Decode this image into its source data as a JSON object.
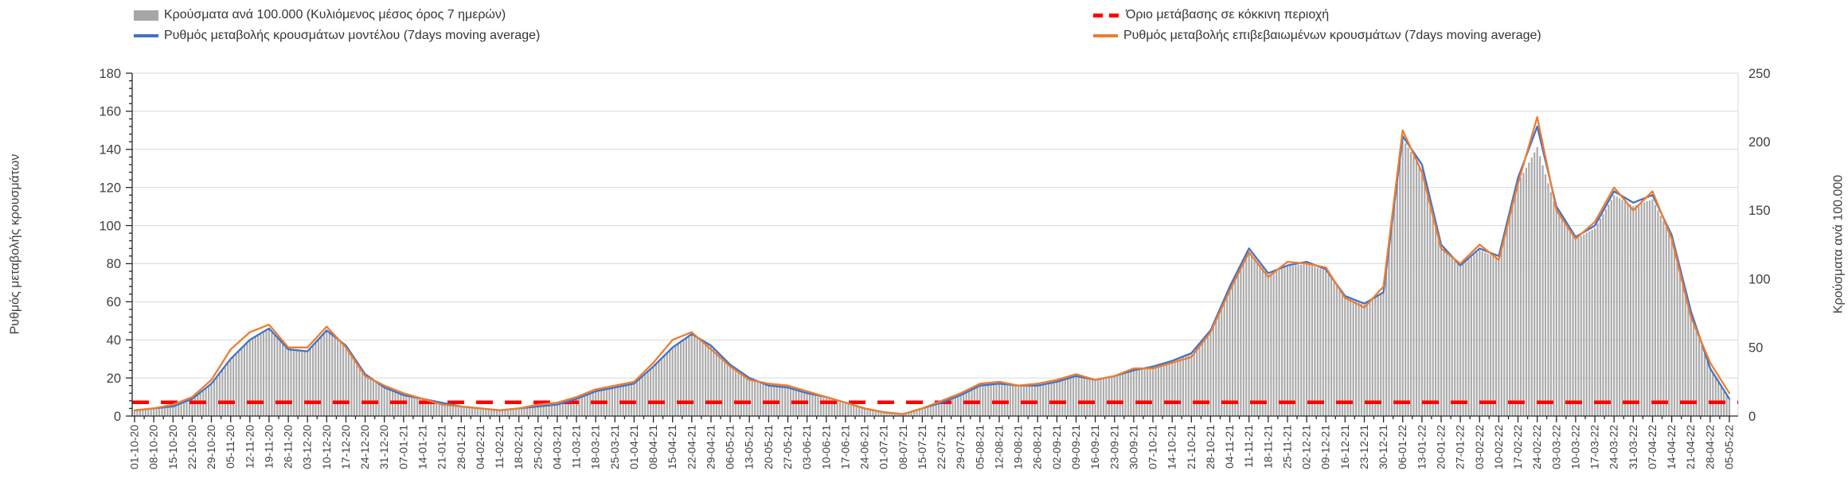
{
  "legend": [
    {
      "label": "Κρούσματα ανά 100.000 (Κυλιόμενος μέσος όρος 7 ημερών)",
      "type": "bar",
      "color": "#a6a6a6"
    },
    {
      "label": "Ρυθμός μεταβολής κρουσμάτων μοντέλου (7days moving average)",
      "type": "line",
      "color": "#4472c4"
    },
    {
      "label": "Όριο μετάβασης σε κόκκινη περιοχή",
      "type": "dash",
      "color": "#ff0000"
    },
    {
      "label": "Ρυθμός μεταβολής επιβεβαιωμένων κρουσμάτων (7days moving average)",
      "type": "line",
      "color": "#ed7d31"
    }
  ],
  "chart_data": {
    "type": "bar",
    "subtype": "combo-bar-line",
    "grid": "horizontal",
    "legend_position": "top",
    "left_axis": {
      "label": "Ρυθμός μεταβολής κρουσμάτων",
      "min": 0,
      "max": 180,
      "step": 20,
      "minor_step": 4
    },
    "right_axis": {
      "label": "Κρούσματα ανά 100.000",
      "min": 0,
      "max": 250,
      "step": 50
    },
    "categories": [
      "01-10-20",
      "08-10-20",
      "15-10-20",
      "22-10-20",
      "29-10-20",
      "05-11-20",
      "12-11-20",
      "19-11-20",
      "26-11-20",
      "03-12-20",
      "10-12-20",
      "17-12-20",
      "24-12-20",
      "31-12-20",
      "07-01-21",
      "14-01-21",
      "21-01-21",
      "28-01-21",
      "04-02-21",
      "11-02-21",
      "18-02-21",
      "25-02-21",
      "04-03-21",
      "11-03-21",
      "18-03-21",
      "25-03-21",
      "01-04-21",
      "08-04-21",
      "15-04-21",
      "22-04-21",
      "29-04-21",
      "06-05-21",
      "13-05-21",
      "20-05-21",
      "27-05-21",
      "03-06-21",
      "10-06-21",
      "17-06-21",
      "24-06-21",
      "01-07-21",
      "08-07-21",
      "15-07-21",
      "22-07-21",
      "29-07-21",
      "05-08-21",
      "12-08-21",
      "19-08-21",
      "26-08-21",
      "02-09-21",
      "09-09-21",
      "16-09-21",
      "23-09-21",
      "30-09-21",
      "07-10-21",
      "14-10-21",
      "21-10-21",
      "28-10-21",
      "04-11-21",
      "11-11-21",
      "18-11-21",
      "25-11-21",
      "02-12-21",
      "09-12-21",
      "16-12-21",
      "23-12-21",
      "30-12-21",
      "06-01-22",
      "13-01-22",
      "20-01-22",
      "27-01-22",
      "03-02-22",
      "10-02-22",
      "17-02-22",
      "24-02-22",
      "03-03-22",
      "10-03-22",
      "17-03-22",
      "24-03-22",
      "31-03-22",
      "07-04-22",
      "14-04-22",
      "21-04-22",
      "28-04-22",
      "05-05-22"
    ],
    "series": [
      {
        "name": "Κρούσματα ανά 100.000 (Κυλιόμενος μέσος όρος 7 ημερών)",
        "type": "bar",
        "axis": "right",
        "color": "#ababab",
        "values": [
          4,
          5,
          7,
          12,
          23,
          41,
          55,
          63,
          48,
          47,
          62,
          51,
          30,
          21,
          15,
          12,
          9,
          7,
          5,
          4,
          5,
          7,
          8,
          12,
          18,
          21,
          23,
          36,
          50,
          59,
          51,
          37,
          27,
          22,
          21,
          16,
          13,
          9,
          5,
          3,
          1,
          5,
          9,
          15,
          22,
          23,
          22,
          22,
          25,
          29,
          26,
          29,
          33,
          36,
          40,
          45,
          62,
          94,
          120,
          103,
          109,
          111,
          106,
          87,
          81,
          90,
          202,
          180,
          124,
          109,
          121,
          115,
          170,
          196,
          150,
          129,
          137,
          161,
          153,
          158,
          130,
          75,
          34,
          12
        ]
      },
      {
        "name": "Ρυθμός μεταβολής κρουσμάτων μοντέλου (7days moving average)",
        "type": "line",
        "axis": "left",
        "color": "#4472c4",
        "values": [
          3,
          4,
          5,
          9,
          17,
          30,
          40,
          46,
          35,
          34,
          45,
          37,
          22,
          15,
          11,
          9,
          7,
          5,
          4,
          3,
          4,
          5,
          6,
          9,
          13,
          15,
          17,
          26,
          36,
          43,
          37,
          27,
          20,
          16,
          15,
          12,
          10,
          7,
          4,
          2,
          1,
          4,
          7,
          11,
          16,
          17,
          16,
          16,
          18,
          21,
          19,
          21,
          24,
          26,
          29,
          33,
          45,
          68,
          88,
          75,
          79,
          81,
          77,
          63,
          59,
          65,
          147,
          132,
          90,
          79,
          88,
          84,
          125,
          152,
          110,
          94,
          100,
          118,
          112,
          116,
          95,
          55,
          25,
          9
        ]
      },
      {
        "name": "Ρυθμός μεταβολής επιβεβαιωμένων κρουσμάτων (7days moving average)",
        "type": "line",
        "axis": "left",
        "color": "#ed7d31",
        "values": [
          3,
          4,
          6,
          10,
          19,
          35,
          44,
          48,
          36,
          36,
          47,
          36,
          21,
          16,
          12,
          9,
          6,
          5,
          4,
          3,
          4,
          6,
          7,
          10,
          14,
          16,
          18,
          28,
          40,
          44,
          35,
          26,
          19,
          17,
          16,
          13,
          10,
          7,
          4,
          2,
          1,
          4,
          8,
          12,
          17,
          18,
          16,
          17,
          19,
          22,
          19,
          21,
          25,
          25,
          28,
          31,
          44,
          66,
          86,
          73,
          81,
          80,
          78,
          62,
          57,
          68,
          150,
          128,
          88,
          80,
          90,
          82,
          122,
          157,
          108,
          93,
          102,
          120,
          108,
          118,
          93,
          52,
          28,
          12
        ]
      },
      {
        "name": "Όριο μετάβασης σε κόκκινη περιοχή",
        "type": "threshold",
        "axis": "right",
        "color": "#ff0000",
        "value": 10
      }
    ]
  }
}
